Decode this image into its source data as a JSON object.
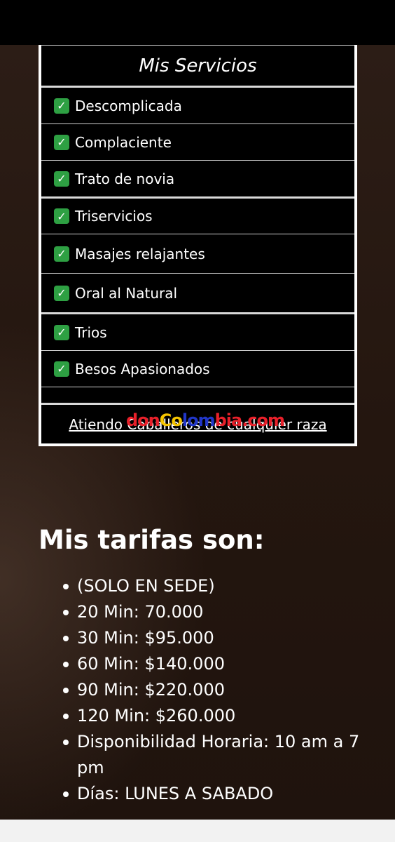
{
  "services": {
    "title": "Mis Servicios",
    "items": [
      "Descomplicada",
      "Complaciente",
      "Trato de novia",
      "Triservicios",
      "Masajes relajantes",
      "Oral al Natural",
      "Trios",
      "Besos Apasionados"
    ],
    "footer_link": "Atiendo Caballeros de cualquier raza",
    "check_icon": "check-mark-button-icon",
    "check_color": "#2ea043"
  },
  "watermark": {
    "part1": "don",
    "part2": "Co",
    "part3": "lom",
    "part4": "bia.com"
  },
  "tarifas": {
    "title": "Mis tarifas son:",
    "items": [
      "(SOLO EN SEDE)",
      "20 Min: 70.000",
      "30 Min: $95.000",
      "60 Min: $140.000",
      "90 Min: $220.000",
      "120 Min: $260.000",
      "Disponibilidad Horaria: 10 am a 7 pm",
      "Días: LUNES A SABADO"
    ]
  }
}
